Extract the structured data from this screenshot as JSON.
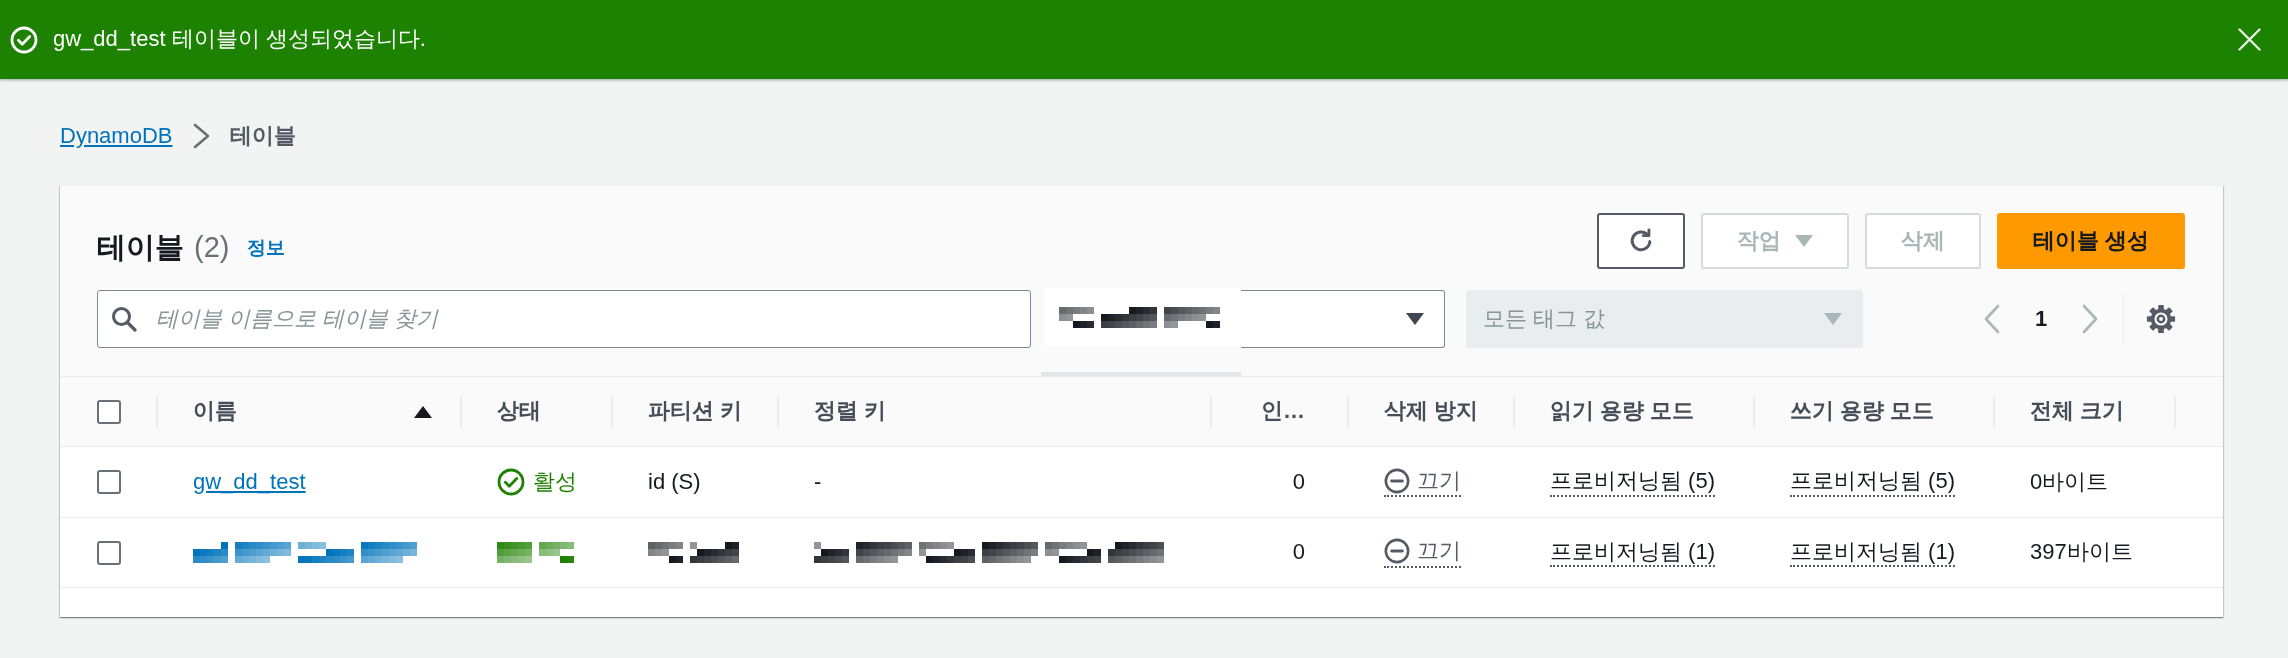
{
  "notification": {
    "kind": "success",
    "message": "gw_dd_test 테이블이 생성되었습니다.",
    "dismissible": true
  },
  "breadcrumb": [
    {
      "label": "DynamoDB",
      "current": false
    },
    {
      "label": "테이블",
      "current": true
    }
  ],
  "panel": {
    "title": "테이블",
    "count": "(2)",
    "info_link": "정보",
    "actions": [
      {
        "kind": "refresh",
        "disabled": false
      },
      {
        "kind": "dropdown",
        "label": "작업",
        "disabled": true
      },
      {
        "kind": "secondary",
        "label": "삭제",
        "disabled": true
      },
      {
        "kind": "primary",
        "label": "테이블 생성",
        "disabled": false
      }
    ],
    "search": {
      "placeholder": "테이블 이름으로 테이블 찾기"
    },
    "tag_key_filter": {
      "redacted": true
    },
    "tag_value_filter": {
      "placeholder": "모든 태그 값",
      "disabled": true
    },
    "pagination": {
      "page": "1",
      "previous_disabled": true,
      "next_disabled": true
    }
  },
  "table": {
    "select_all": {
      "checked": false
    },
    "columns": [
      {
        "label": "이름",
        "sorted": true,
        "kind": "text"
      },
      {
        "label": "상태",
        "sorted": false,
        "kind": "text"
      },
      {
        "label": "파티션 키",
        "sorted": false,
        "kind": "text"
      },
      {
        "label": "정렬 키",
        "sorted": false,
        "kind": "text"
      },
      {
        "label": "인…",
        "sorted": false,
        "kind": "numeric"
      },
      {
        "label": "삭제 방지",
        "sorted": false,
        "kind": "text"
      },
      {
        "label": "읽기 용량 모드",
        "sorted": false,
        "kind": "text"
      },
      {
        "label": "쓰기 용량 모드",
        "sorted": false,
        "kind": "text"
      },
      {
        "label": "전체 크기",
        "sorted": false,
        "kind": "text"
      }
    ],
    "rows": [
      {
        "selected": false,
        "redacted": false,
        "name": "gw_dd_test",
        "status": {
          "label": "활성",
          "kind": "active"
        },
        "partition_key": "id (S)",
        "sort_key": "-",
        "column_5": "0",
        "deletion_protection": {
          "label": "끄기",
          "enabled": false
        },
        "read_capacity": "프로비저닝됨 (5)",
        "write_capacity": "프로비저닝됨 (5)",
        "total_size": "0바이트"
      },
      {
        "selected": false,
        "redacted": true,
        "column_5": "0",
        "deletion_protection": {
          "label": "끄기",
          "enabled": false
        },
        "read_capacity": "프로비저닝됨 (1)",
        "write_capacity": "프로비저닝됨 (1)",
        "total_size": "397바이트"
      }
    ]
  }
}
